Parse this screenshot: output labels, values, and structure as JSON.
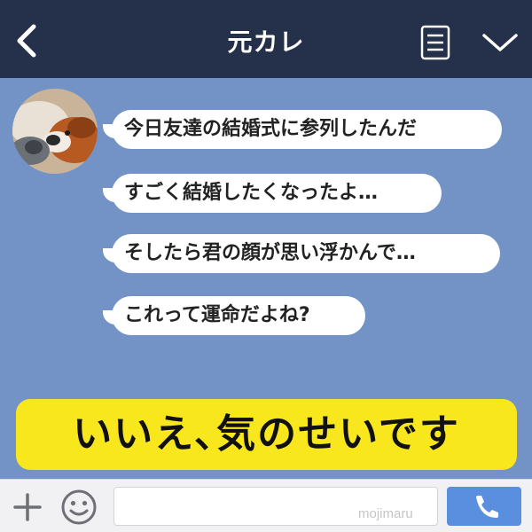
{
  "header": {
    "title": "元カレ",
    "back_icon": "chevron-left-icon",
    "menu_icon": "memo-list-icon",
    "more_icon": "chevron-down-icon",
    "bg_color": "#25304a"
  },
  "chat": {
    "bg_color": "#7393c6",
    "avatar": "dog-photo-avatar",
    "messages": [
      "今日友達の結婚式に参列したんだ",
      "すごく結婚したくなったよ…",
      "そしたら君の顔が思い浮かんで…",
      "これって運命だよね?"
    ]
  },
  "banner": {
    "text": "いいえ､気のせいです",
    "bg_color": "#f8e71c"
  },
  "footer": {
    "plus_icon": "plus-icon",
    "emoji_icon": "smiley-icon",
    "input_value": "",
    "watermark": "mojimaru",
    "call_icon": "phone-icon",
    "call_color": "#5a8fe0"
  }
}
